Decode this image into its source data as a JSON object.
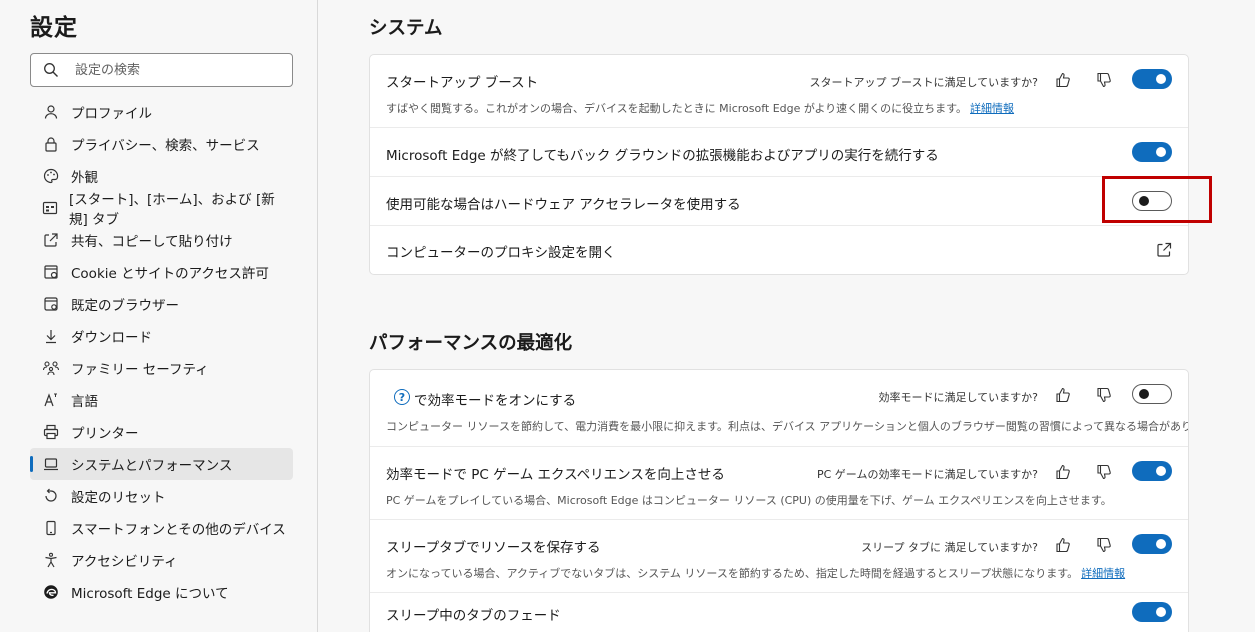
{
  "sidebar": {
    "title": "設定",
    "search_placeholder": "設定の検索",
    "items": [
      {
        "label": "プロファイル",
        "icon": "profile-icon"
      },
      {
        "label": "プライバシー、検索、サービス",
        "icon": "lock-icon"
      },
      {
        "label": "外観",
        "icon": "palette-icon"
      },
      {
        "label": "[スタート]、[ホーム]、および [新規] タブ",
        "icon": "home-tab-icon"
      },
      {
        "label": "共有、コピーして貼り付け",
        "icon": "share-icon"
      },
      {
        "label": "Cookie とサイトのアクセス許可",
        "icon": "cookie-icon"
      },
      {
        "label": "既定のブラウザー",
        "icon": "browser-icon"
      },
      {
        "label": "ダウンロード",
        "icon": "download-icon"
      },
      {
        "label": "ファミリー セーフティ",
        "icon": "family-icon"
      },
      {
        "label": "言語",
        "icon": "language-icon"
      },
      {
        "label": "プリンター",
        "icon": "printer-icon"
      },
      {
        "label": "システムとパフォーマンス",
        "icon": "laptop-icon",
        "active": true
      },
      {
        "label": "設定のリセット",
        "icon": "reset-icon"
      },
      {
        "label": "スマートフォンとその他のデバイス",
        "icon": "phone-icon"
      },
      {
        "label": "アクセシビリティ",
        "icon": "accessibility-icon"
      },
      {
        "label": "Microsoft Edge について",
        "icon": "edge-icon"
      }
    ]
  },
  "system": {
    "title": "システム",
    "startup_boost": {
      "title": "スタートアップ ブースト",
      "feedback": "スタートアップ ブーストに満足していますか?",
      "desc": "すばやく閲覧する。これがオンの場合、デバイスを起動したときに Microsoft Edge がより速く開くのに役立ちます。",
      "link": "詳細情報",
      "enabled": true
    },
    "background": {
      "title": "Microsoft Edge が終了してもバック グラウンドの拡張機能およびアプリの実行を続行する",
      "enabled": true
    },
    "hardware_accel": {
      "title": "使用可能な場合はハードウェア アクセラレータを使用する",
      "enabled": false
    },
    "proxy": {
      "title": "コンピューターのプロキシ設定を開く"
    }
  },
  "performance": {
    "title": "パフォーマンスの最適化",
    "efficiency": {
      "title": "で効率モードをオンにする",
      "feedback": "効率モードに満足していますか?",
      "desc": "コンピューター リソースを節約して、電力消費を最小限に抑えます。利点は、デバイス アプリケーションと個人のブラウザー閲覧の習慣によって異なる場合があります。",
      "enabled": false
    },
    "pc_gaming": {
      "title": "効率モードで PC ゲーム エクスペリエンスを向上させる",
      "feedback": "PC ゲームの効率モードに満足していますか?",
      "desc": "PC ゲームをプレイしている場合、Microsoft Edge はコンピューター リソース (CPU) の使用量を下げ、ゲーム エクスペリエンスを向上させます。",
      "enabled": true
    },
    "sleeping_tabs": {
      "title": "スリープタブでリソースを保存する",
      "feedback": "スリープ タブに 満足していますか?",
      "desc": "オンになっている場合、アクティブでないタブは、システム リソースを節約するため、指定した時間を経過するとスリープ状態になります。",
      "link": "詳細情報",
      "enabled": true
    },
    "fade_tabs": {
      "title": "スリープ中のタブのフェード",
      "enabled": true
    }
  }
}
